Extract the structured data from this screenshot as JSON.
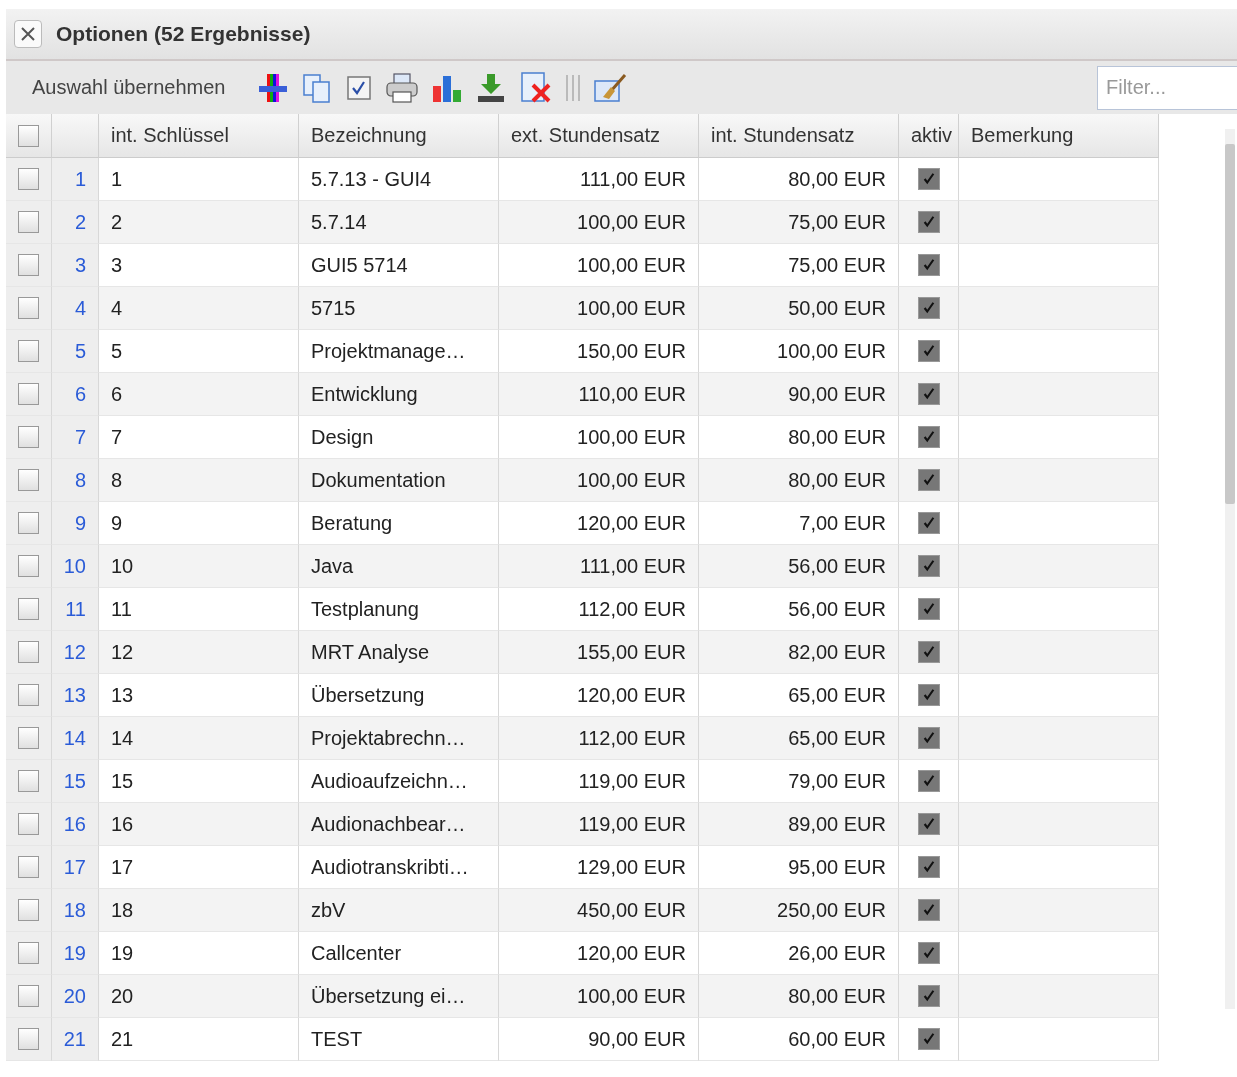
{
  "window": {
    "title": "Optionen (52 Ergebnisse)"
  },
  "toolbar": {
    "apply_label": "Auswahl übernehmen",
    "filter": {
      "placeholder": "Filter..."
    }
  },
  "table": {
    "columns": [
      "int. Schlüssel",
      "Bezeichnung",
      "ext. Stundensatz",
      "int. Stundensatz",
      "aktiv",
      "Bemerkung"
    ],
    "header_selected": false,
    "rows": [
      {
        "number": "1",
        "key": "1",
        "name": "5.7.13 - GUI4",
        "ext_rate": "111,00 EUR",
        "int_rate": "80,00 EUR",
        "active": true,
        "selected": false
      },
      {
        "number": "2",
        "key": "2",
        "name": "5.7.14",
        "ext_rate": "100,00 EUR",
        "int_rate": "75,00 EUR",
        "active": true,
        "selected": false
      },
      {
        "number": "3",
        "key": "3",
        "name": "GUI5 5714",
        "ext_rate": "100,00 EUR",
        "int_rate": "75,00 EUR",
        "active": true,
        "selected": false
      },
      {
        "number": "4",
        "key": "4",
        "name": "5715",
        "ext_rate": "100,00 EUR",
        "int_rate": "50,00 EUR",
        "active": true,
        "selected": false
      },
      {
        "number": "5",
        "key": "5",
        "name": "Projektmanage…",
        "ext_rate": "150,00 EUR",
        "int_rate": "100,00 EUR",
        "active": true,
        "selected": false
      },
      {
        "number": "6",
        "key": "6",
        "name": "Entwicklung",
        "ext_rate": "110,00 EUR",
        "int_rate": "90,00 EUR",
        "active": true,
        "selected": false
      },
      {
        "number": "7",
        "key": "7",
        "name": "Design",
        "ext_rate": "100,00 EUR",
        "int_rate": "80,00 EUR",
        "active": true,
        "selected": false
      },
      {
        "number": "8",
        "key": "8",
        "name": "Dokumentation",
        "ext_rate": "100,00 EUR",
        "int_rate": "80,00 EUR",
        "active": true,
        "selected": false
      },
      {
        "number": "9",
        "key": "9",
        "name": "Beratung",
        "ext_rate": "120,00 EUR",
        "int_rate": "7,00 EUR",
        "active": true,
        "selected": false
      },
      {
        "number": "10",
        "key": "10",
        "name": "Java",
        "ext_rate": "111,00 EUR",
        "int_rate": "56,00 EUR",
        "active": true,
        "selected": false
      },
      {
        "number": "11",
        "key": "11",
        "name": "Testplanung",
        "ext_rate": "112,00 EUR",
        "int_rate": "56,00 EUR",
        "active": true,
        "selected": false
      },
      {
        "number": "12",
        "key": "12",
        "name": "MRT Analyse",
        "ext_rate": "155,00 EUR",
        "int_rate": "82,00 EUR",
        "active": true,
        "selected": false
      },
      {
        "number": "13",
        "key": "13",
        "name": "Übersetzung",
        "ext_rate": "120,00 EUR",
        "int_rate": "65,00 EUR",
        "active": true,
        "selected": false
      },
      {
        "number": "14",
        "key": "14",
        "name": "Projektabrechn…",
        "ext_rate": "112,00 EUR",
        "int_rate": "65,00 EUR",
        "active": true,
        "selected": false
      },
      {
        "number": "15",
        "key": "15",
        "name": "Audioaufzeichn…",
        "ext_rate": "119,00 EUR",
        "int_rate": "79,00 EUR",
        "active": true,
        "selected": false
      },
      {
        "number": "16",
        "key": "16",
        "name": "Audionachbear…",
        "ext_rate": "119,00 EUR",
        "int_rate": "89,00 EUR",
        "active": true,
        "selected": false
      },
      {
        "number": "17",
        "key": "17",
        "name": "Audiotranskribti…",
        "ext_rate": "129,00 EUR",
        "int_rate": "95,00 EUR",
        "active": true,
        "selected": false
      },
      {
        "number": "18",
        "key": "18",
        "name": "zbV",
        "ext_rate": "450,00 EUR",
        "int_rate": "250,00 EUR",
        "active": true,
        "selected": false
      },
      {
        "number": "19",
        "key": "19",
        "name": "Callcenter",
        "ext_rate": "120,00 EUR",
        "int_rate": "26,00 EUR",
        "active": true,
        "selected": false
      },
      {
        "number": "20",
        "key": "20",
        "name": "Übersetzung ei…",
        "ext_rate": "100,00 EUR",
        "int_rate": "80,00 EUR",
        "active": true,
        "selected": false
      },
      {
        "number": "21",
        "key": "21",
        "name": "TEST",
        "ext_rate": "90,00 EUR",
        "int_rate": "60,00 EUR",
        "active": true,
        "selected": false
      }
    ]
  }
}
